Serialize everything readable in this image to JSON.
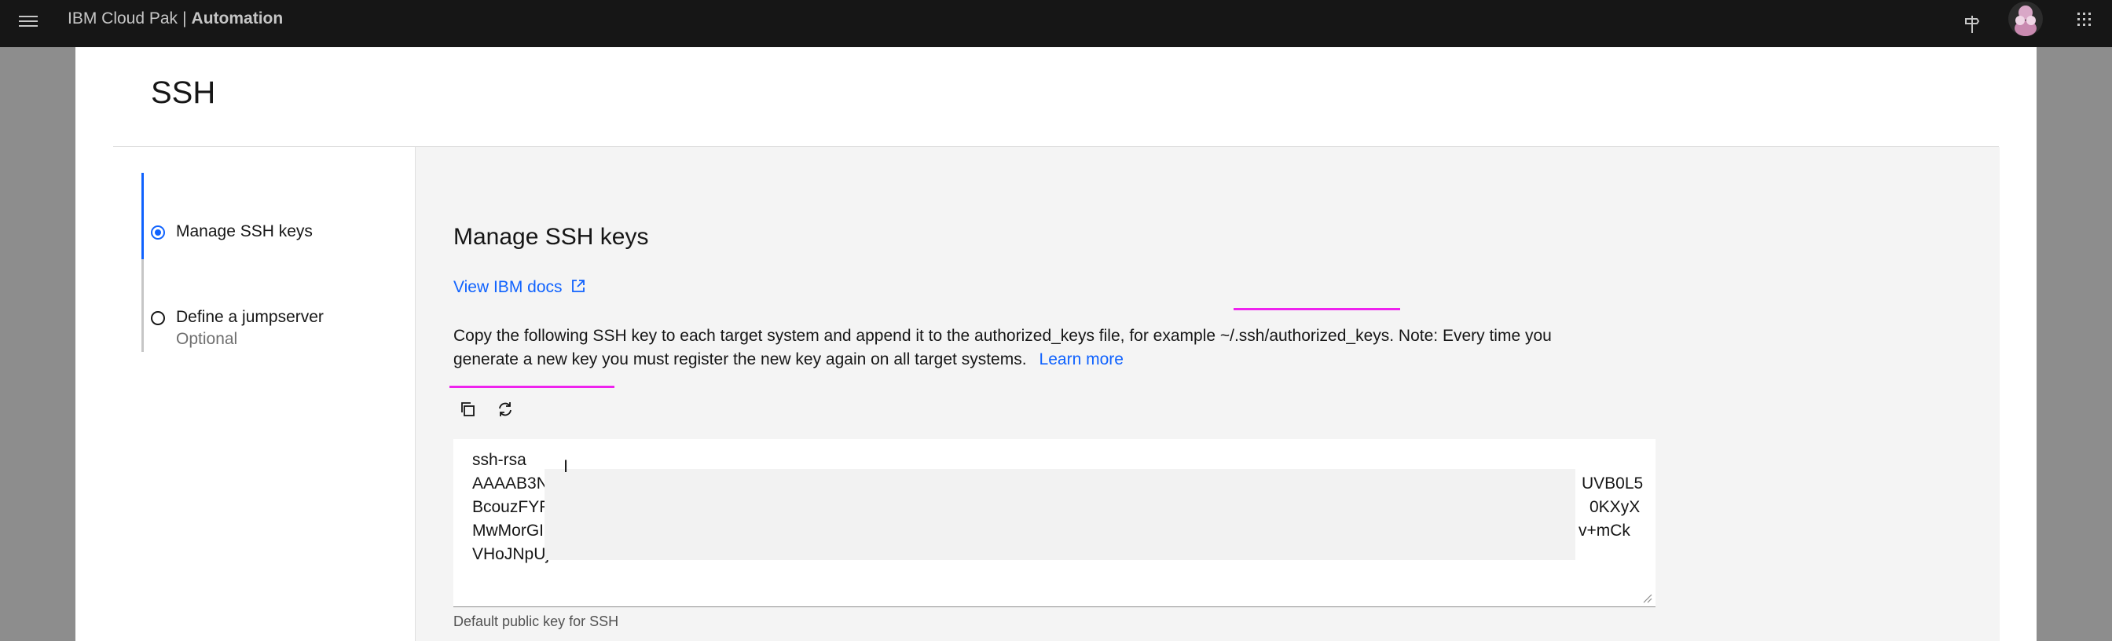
{
  "header": {
    "brand_prefix": "IBM Cloud Pak",
    "brand_separator": "|",
    "brand_product": "Automation",
    "icons": [
      "menu-icon",
      "pin-icon",
      "user-avatar",
      "app-switcher-icon"
    ]
  },
  "page": {
    "title": "SSH"
  },
  "steps": [
    {
      "label": "Manage SSH keys",
      "state": "current"
    },
    {
      "label": "Define a jumpserver",
      "sub": "Optional",
      "state": "incomplete"
    }
  ],
  "content": {
    "section_title": "Manage SSH keys",
    "docs_link": "View IBM docs",
    "description": "Copy the following SSH key to each target system and append it to the authorized_keys file, for example ~/.ssh/authorized_keys. Note: Every time you generate a new key you must register the new key again on all target systems.",
    "learn_more": "Learn more",
    "toolbar": {
      "copy_icon": "copy-icon",
      "refresh_icon": "refresh-icon"
    },
    "key_value": "ssh-rsa\nAAAAB3N\nBcouzFYF\nMwMorGI\nVHoJNpUj55",
    "key_tails": [
      "UVB0L5",
      "0KXyX",
      "v+mCk"
    ],
    "helper_text": "Default public key for SSH"
  },
  "colors": {
    "header_bg": "#161616",
    "accent": "#0f62fe",
    "highlight": "#ee22ee"
  }
}
